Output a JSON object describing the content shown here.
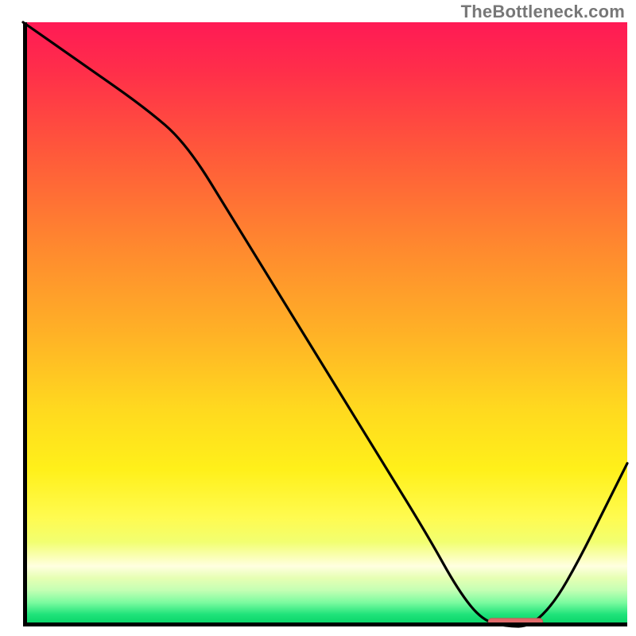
{
  "watermark": {
    "text": "TheBottleneck.com"
  },
  "chart_data": {
    "type": "line",
    "title": "",
    "xlabel": "",
    "ylabel": "",
    "xlim": [
      0,
      100
    ],
    "ylim": [
      0,
      100
    ],
    "grid": false,
    "legend": false,
    "background": {
      "description": "vertical gradient red→orange→yellow→pale→green (bottleneck heatmap)",
      "stops": [
        {
          "pct": 0,
          "color": "#ff1a55"
        },
        {
          "pct": 22,
          "color": "#ff5a3a"
        },
        {
          "pct": 52,
          "color": "#ffb326"
        },
        {
          "pct": 74,
          "color": "#fff01a"
        },
        {
          "pct": 90,
          "color": "#ffffe0"
        },
        {
          "pct": 100,
          "color": "#03cf63"
        }
      ]
    },
    "series": [
      {
        "name": "bottleneck-curve",
        "x": [
          0,
          10,
          20,
          27,
          35,
          43,
          51,
          59,
          67,
          72,
          76,
          80,
          84,
          88,
          92,
          96,
          100
        ],
        "y": [
          100,
          93,
          86,
          80,
          67,
          54,
          41,
          28,
          15,
          6,
          1,
          0,
          0,
          4,
          11,
          19,
          27
        ]
      }
    ],
    "annotations": [
      {
        "name": "optimal-range-marker",
        "type": "bar",
        "x_range": [
          77,
          86
        ],
        "y": 0,
        "height": 1.2,
        "color": "#e06a6a"
      }
    ]
  }
}
